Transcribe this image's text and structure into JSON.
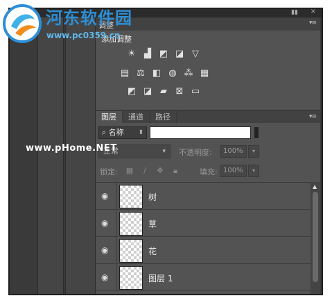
{
  "watermark": {
    "site_name": "河东软件园",
    "site_url": "www.pc0359.cn",
    "center_text": "www.pHome.NET"
  },
  "adjustments_panel": {
    "tab_label": "调整",
    "add_label": "添加调整",
    "menu_glyph": "▾≡",
    "icon_rows": [
      [
        "brightness-contrast-icon",
        "levels-icon",
        "curves-icon",
        "exposure-icon",
        "vibrance-icon"
      ],
      [
        "hue-saturation-icon",
        "color-balance-icon",
        "black-white-icon",
        "photo-filter-icon",
        "channel-mixer-icon",
        "color-lookup-icon"
      ],
      [
        "invert-icon",
        "posterize-icon",
        "threshold-icon",
        "selective-color-icon",
        "gradient-map-icon"
      ]
    ]
  },
  "layers_panel": {
    "tabs": [
      {
        "label": "图层",
        "active": true
      },
      {
        "label": "通道",
        "active": false
      },
      {
        "label": "路径",
        "active": false
      }
    ],
    "menu_glyph": "▾≡",
    "filter": {
      "kind_label": "名称",
      "value": ""
    },
    "blend_mode": "正常",
    "opacity_label": "不透明度:",
    "opacity_value": "100%",
    "lock_label": "锁定:",
    "fill_label": "填充:",
    "fill_value": "100%",
    "layers": [
      {
        "name": "树"
      },
      {
        "name": "草"
      },
      {
        "name": "花"
      },
      {
        "name": "图层 1"
      }
    ]
  },
  "colors": {
    "panel_bg": "#535353",
    "tab_bar_bg": "#424242",
    "watermark_blue": "#2d8fd6"
  }
}
